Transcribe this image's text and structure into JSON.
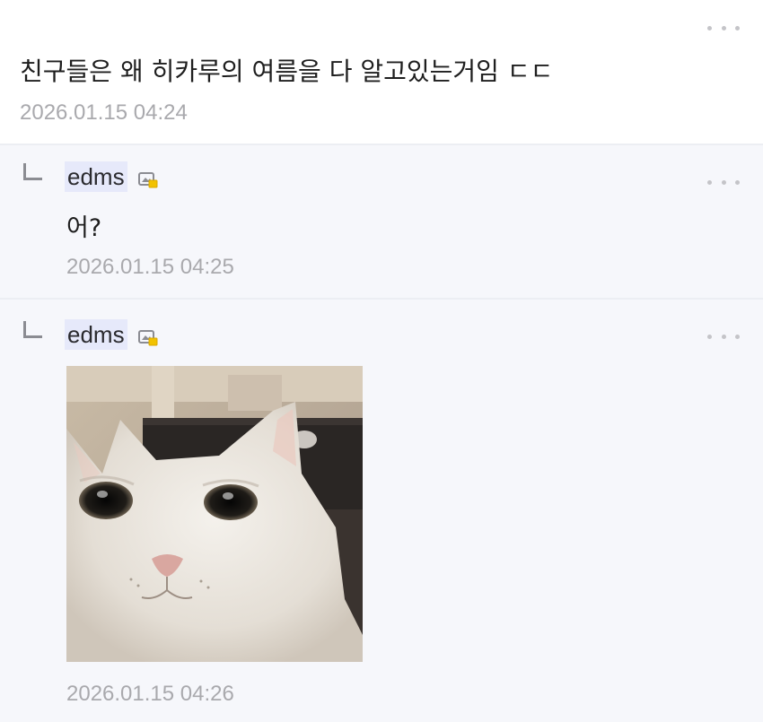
{
  "main_comment": {
    "text": "친구들은 왜 히카루의 여름을 다 알고있는거임 ㄷㄷ",
    "timestamp": "2026.01.15 04:24"
  },
  "replies": [
    {
      "username": "edms",
      "text": "어?",
      "timestamp": "2026.01.15 04:25"
    },
    {
      "username": "edms",
      "image": "white-cat-photo",
      "timestamp": "2026.01.15 04:26"
    }
  ],
  "icons": {
    "more": "more-dots-icon",
    "reply": "reply-arrow-icon",
    "user_badge": "user-badge-icon"
  },
  "colors": {
    "reply_background": "#f6f7fb",
    "username_highlight": "#e6e9fa",
    "timestamp": "#a9a9ad",
    "dots": "#c4c4c8"
  }
}
